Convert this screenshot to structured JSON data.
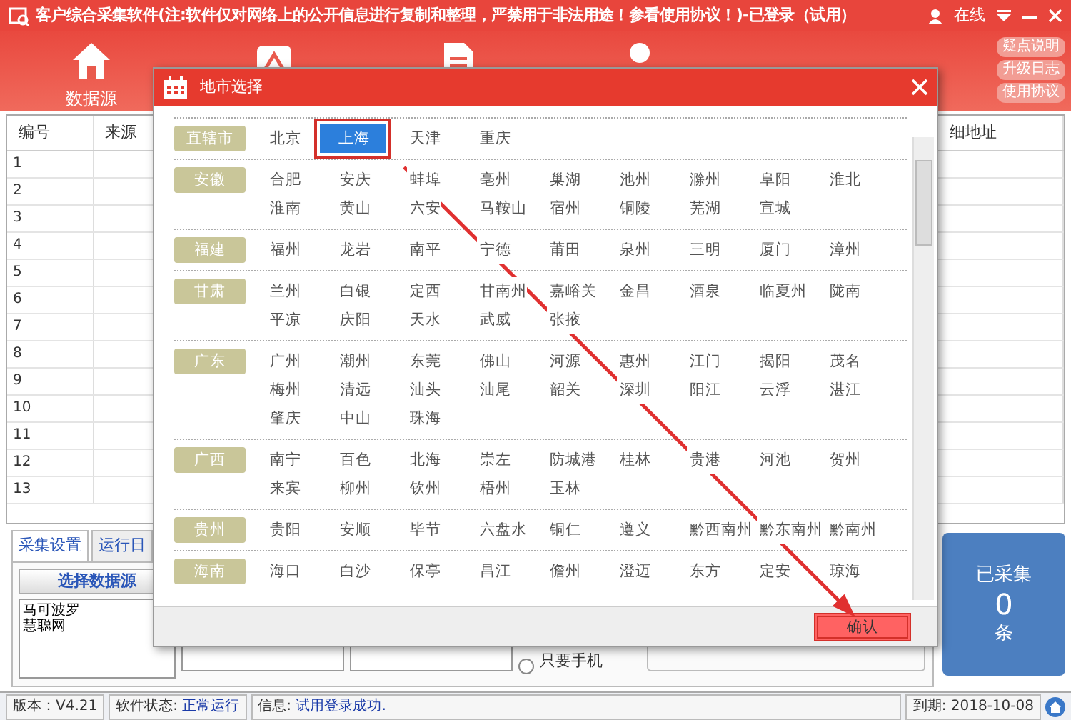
{
  "window": {
    "title": "客户综合采集软件(注:软件仅对网络上的公开信息进行复制和整理，严禁用于非法用途！参看使用协议！)-已登录（试用）",
    "online": "在线"
  },
  "toolbar": [
    {
      "kind": "home",
      "label": "数据源"
    },
    {
      "kind": "company"
    },
    {
      "kind": "document"
    },
    {
      "kind": "person"
    }
  ],
  "side_links": [
    "疑点说明",
    "升级日志",
    "使用协议"
  ],
  "table": {
    "columns": [
      "编号",
      "来源",
      "细地址"
    ],
    "rows": [
      "1",
      "2",
      "3",
      "4",
      "5",
      "6",
      "7",
      "8",
      "9",
      "10",
      "11",
      "12",
      "13"
    ]
  },
  "tabs": [
    {
      "label": "采集设置",
      "selected": true
    },
    {
      "label": "运行日",
      "selected": false
    }
  ],
  "select_source_button": "选择数据源",
  "sources": [
    "马可波罗",
    "慧聪网"
  ],
  "phone_only": {
    "label": "只要手机",
    "checked": false
  },
  "counter": {
    "title": "已采集",
    "value": "0",
    "unit": "条"
  },
  "status_bar": {
    "version": "版本：V4.21",
    "state_label": "软件状态:",
    "state": "正常运行",
    "info_label": "信息:",
    "info": "试用登录成功.",
    "expiry": "到期: 2018-10-08"
  },
  "dialog": {
    "title": "地市选择",
    "confirm": {
      "label": "确认",
      "highlighted": true
    },
    "groups": [
      {
        "province": "直辖市",
        "cities": [
          {
            "name": "北京",
            "selected": false
          },
          {
            "name": "上海",
            "selected": true
          },
          {
            "name": "天津",
            "selected": false
          },
          {
            "name": "重庆",
            "selected": false
          }
        ]
      },
      {
        "province": "安徽",
        "cities": [
          {
            "name": "合肥",
            "selected": false
          },
          {
            "name": "安庆",
            "selected": false
          },
          {
            "name": "蚌埠",
            "selected": false
          },
          {
            "name": "亳州",
            "selected": false
          },
          {
            "name": "巢湖",
            "selected": false
          },
          {
            "name": "池州",
            "selected": false
          },
          {
            "name": "滁州",
            "selected": false
          },
          {
            "name": "阜阳",
            "selected": false
          },
          {
            "name": "淮北",
            "selected": false
          },
          {
            "name": "淮南",
            "selected": false
          },
          {
            "name": "黄山",
            "selected": false
          },
          {
            "name": "六安",
            "selected": false
          },
          {
            "name": "马鞍山",
            "selected": false
          },
          {
            "name": "宿州",
            "selected": false
          },
          {
            "name": "铜陵",
            "selected": false
          },
          {
            "name": "芜湖",
            "selected": false
          },
          {
            "name": "宣城",
            "selected": false
          }
        ]
      },
      {
        "province": "福建",
        "cities": [
          {
            "name": "福州",
            "selected": false
          },
          {
            "name": "龙岩",
            "selected": false
          },
          {
            "name": "南平",
            "selected": false
          },
          {
            "name": "宁德",
            "selected": false
          },
          {
            "name": "莆田",
            "selected": false
          },
          {
            "name": "泉州",
            "selected": false
          },
          {
            "name": "三明",
            "selected": false
          },
          {
            "name": "厦门",
            "selected": false
          },
          {
            "name": "漳州",
            "selected": false
          }
        ]
      },
      {
        "province": "甘肃",
        "cities": [
          {
            "name": "兰州",
            "selected": false
          },
          {
            "name": "白银",
            "selected": false
          },
          {
            "name": "定西",
            "selected": false
          },
          {
            "name": "甘南州",
            "selected": false
          },
          {
            "name": "嘉峪关",
            "selected": false
          },
          {
            "name": "金昌",
            "selected": false
          },
          {
            "name": "酒泉",
            "selected": false
          },
          {
            "name": "临夏州",
            "selected": false
          },
          {
            "name": "陇南",
            "selected": false
          },
          {
            "name": "平凉",
            "selected": false
          },
          {
            "name": "庆阳",
            "selected": false
          },
          {
            "name": "天水",
            "selected": false
          },
          {
            "name": "武威",
            "selected": false
          },
          {
            "name": "张掖",
            "selected": false
          }
        ]
      },
      {
        "province": "广东",
        "cities": [
          {
            "name": "广州",
            "selected": false
          },
          {
            "name": "潮州",
            "selected": false
          },
          {
            "name": "东莞",
            "selected": false
          },
          {
            "name": "佛山",
            "selected": false
          },
          {
            "name": "河源",
            "selected": false
          },
          {
            "name": "惠州",
            "selected": false
          },
          {
            "name": "江门",
            "selected": false
          },
          {
            "name": "揭阳",
            "selected": false
          },
          {
            "name": "茂名",
            "selected": false
          },
          {
            "name": "梅州",
            "selected": false
          },
          {
            "name": "清远",
            "selected": false
          },
          {
            "name": "汕头",
            "selected": false
          },
          {
            "name": "汕尾",
            "selected": false
          },
          {
            "name": "韶关",
            "selected": false
          },
          {
            "name": "深圳",
            "selected": false
          },
          {
            "name": "阳江",
            "selected": false
          },
          {
            "name": "云浮",
            "selected": false
          },
          {
            "name": "湛江",
            "selected": false
          },
          {
            "name": "肇庆",
            "selected": false
          },
          {
            "name": "中山",
            "selected": false
          },
          {
            "name": "珠海",
            "selected": false
          }
        ]
      },
      {
        "province": "广西",
        "cities": [
          {
            "name": "南宁",
            "selected": false
          },
          {
            "name": "百色",
            "selected": false
          },
          {
            "name": "北海",
            "selected": false
          },
          {
            "name": "崇左",
            "selected": false
          },
          {
            "name": "防城港",
            "selected": false
          },
          {
            "name": "桂林",
            "selected": false
          },
          {
            "name": "贵港",
            "selected": false
          },
          {
            "name": "河池",
            "selected": false
          },
          {
            "name": "贺州",
            "selected": false
          },
          {
            "name": "来宾",
            "selected": false
          },
          {
            "name": "柳州",
            "selected": false
          },
          {
            "name": "钦州",
            "selected": false
          },
          {
            "name": "梧州",
            "selected": false
          },
          {
            "name": "玉林",
            "selected": false
          }
        ]
      },
      {
        "province": "贵州",
        "cities": [
          {
            "name": "贵阳",
            "selected": false
          },
          {
            "name": "安顺",
            "selected": false
          },
          {
            "name": "毕节",
            "selected": false
          },
          {
            "name": "六盘水",
            "selected": false
          },
          {
            "name": "铜仁",
            "selected": false
          },
          {
            "name": "遵义",
            "selected": false
          },
          {
            "name": "黔西南州",
            "selected": false
          },
          {
            "name": "黔东南州",
            "selected": false
          },
          {
            "name": "黔南州",
            "selected": false
          }
        ]
      },
      {
        "province": "海南",
        "cities": [
          {
            "name": "海口",
            "selected": false
          },
          {
            "name": "白沙",
            "selected": false
          },
          {
            "name": "保亭",
            "selected": false
          },
          {
            "name": "昌江",
            "selected": false
          },
          {
            "name": "儋州",
            "selected": false
          },
          {
            "name": "澄迈",
            "selected": false
          },
          {
            "name": "东方",
            "selected": false
          },
          {
            "name": "定安",
            "selected": false
          },
          {
            "name": "琼海",
            "selected": false
          }
        ]
      }
    ]
  }
}
